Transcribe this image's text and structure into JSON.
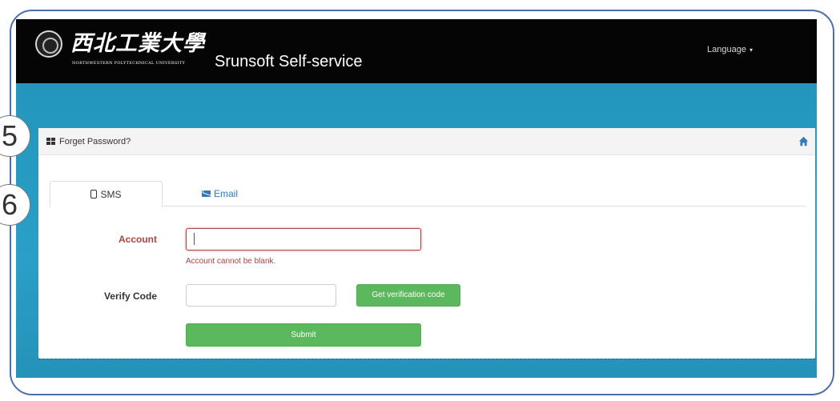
{
  "header": {
    "university_name_cn": "西北工業大學",
    "university_name_en": "NORTHWESTERN POLYTECHNICAL UNIVERSITY",
    "app_title": "Srunsoft Self-service",
    "language_label": "Language",
    "language_caret": "▾"
  },
  "panel": {
    "title": "Forget Password?"
  },
  "tabs": [
    {
      "label": "SMS",
      "icon": "phone-icon",
      "active": true
    },
    {
      "label": "Email",
      "icon": "envelope-icon",
      "active": false
    }
  ],
  "form": {
    "account_label": "Account",
    "account_value": "",
    "account_error": "Account cannot be blank.",
    "verify_label": "Verify Code",
    "verify_value": "",
    "get_code_label": "Get verification code",
    "submit_label": "Submit"
  },
  "annotations": [
    "5",
    "6"
  ],
  "colors": {
    "navbar": "#050505",
    "background": "#2496bd",
    "error": "#a94442",
    "button": "#5cb85c",
    "link": "#337ab7",
    "frame": "#4d6ea8"
  }
}
